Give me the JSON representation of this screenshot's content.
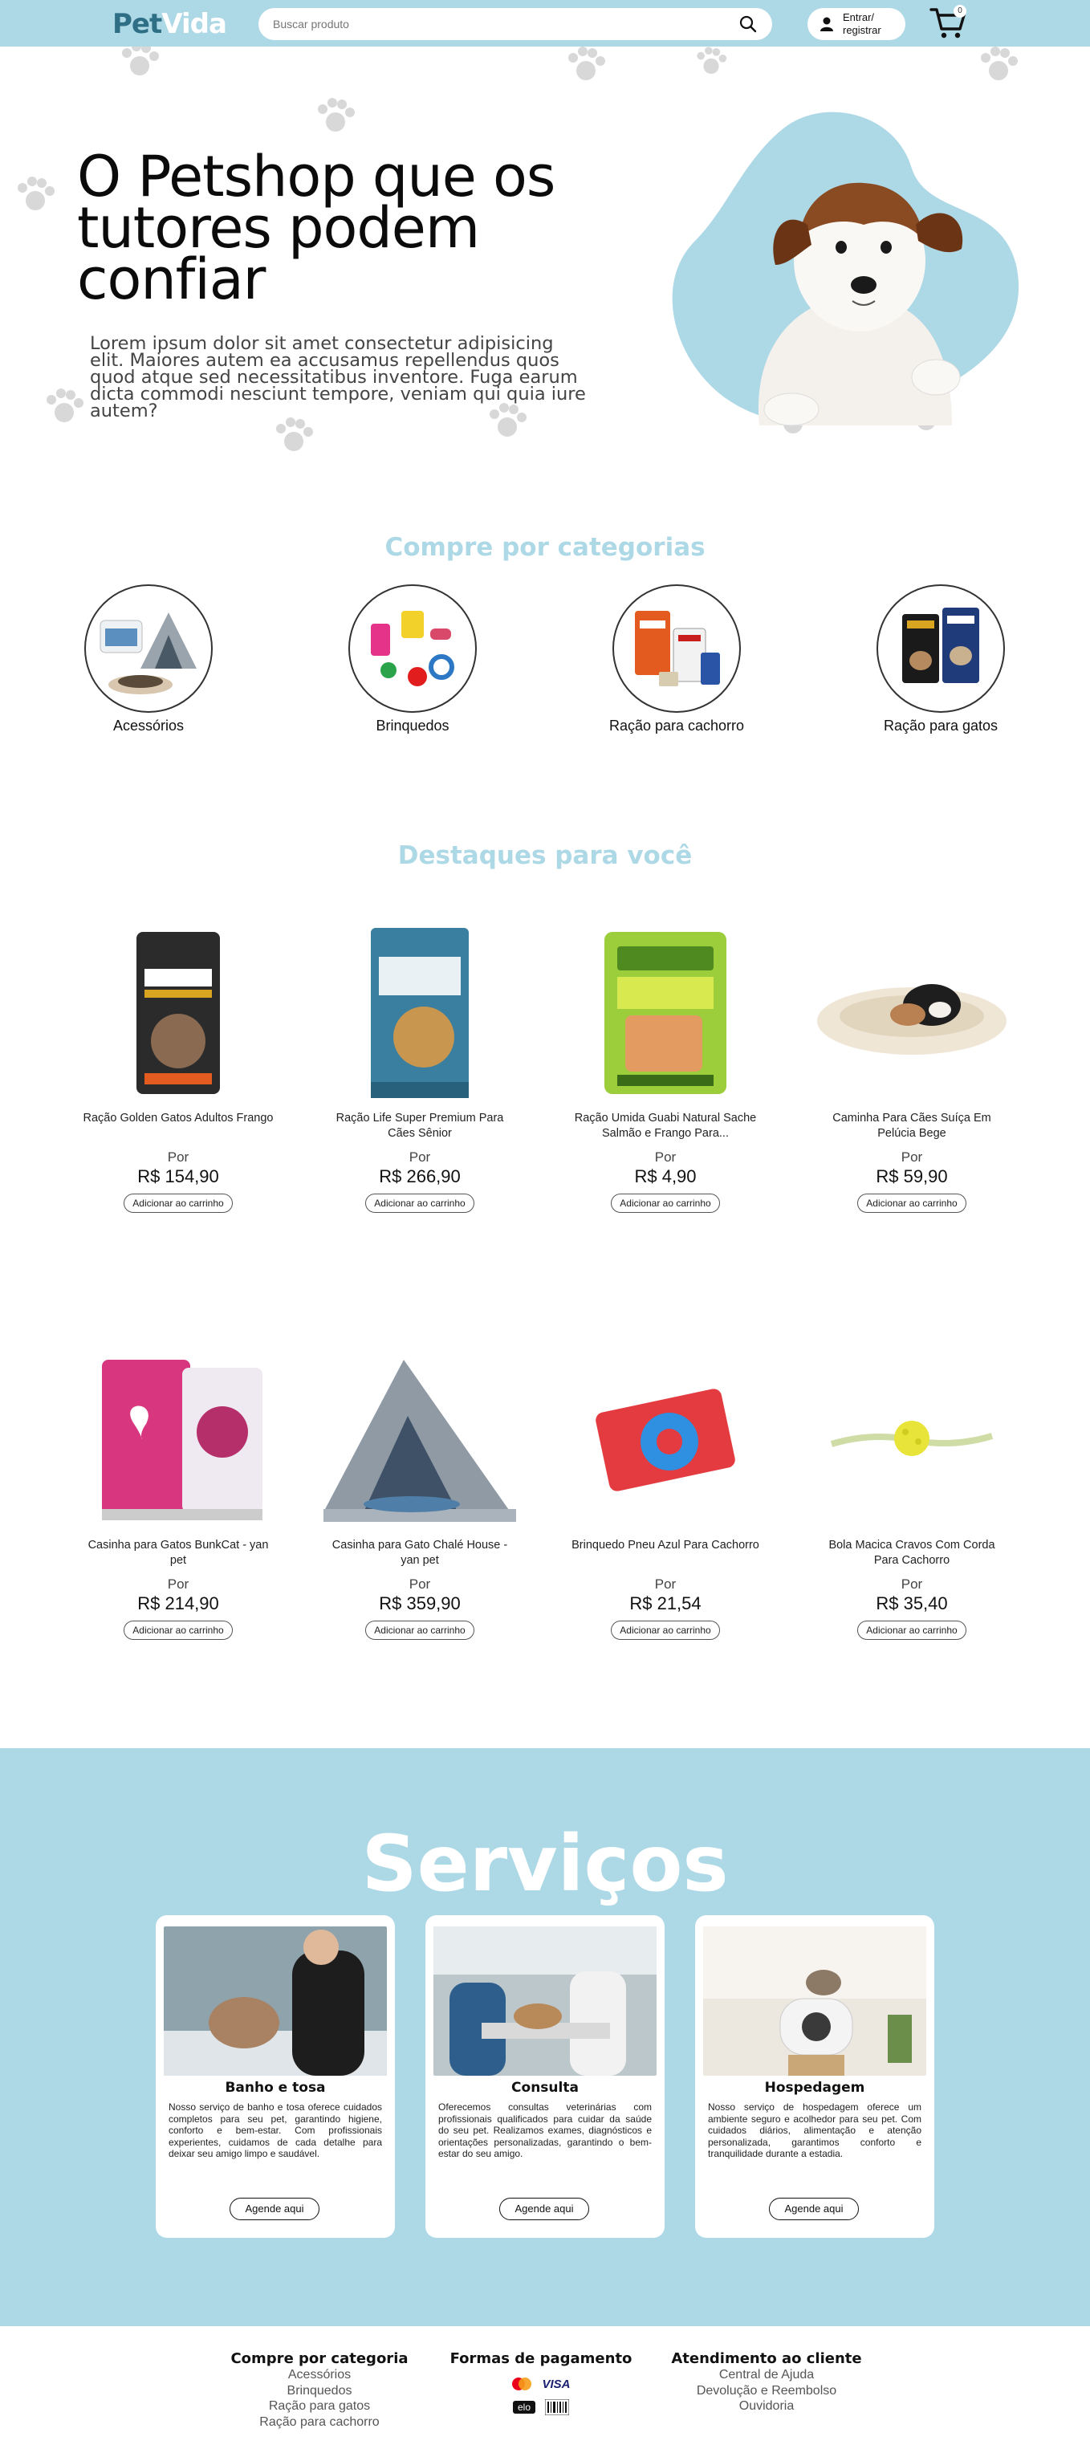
{
  "header": {
    "logo_part1": "Pet",
    "logo_part2": "Vida",
    "search_placeholder": "Buscar produto",
    "login_label_line1": "Entrar/",
    "login_label_line2": "registrar",
    "cart_count": "0"
  },
  "hero": {
    "title": "O Petshop que os tutores podem confiar",
    "text": "Lorem ipsum dolor sit amet consectetur adipisicing elit. Maiores autem ea accusamus repellendus quos quod atque sed necessitatibus inventore. Fuga earum dicta commodi nesciunt tempore, veniam qui quia iure autem?"
  },
  "categories": {
    "title": "Compre por categorias",
    "items": [
      {
        "label": "Acessórios"
      },
      {
        "label": "Brinquedos"
      },
      {
        "label": "Ração para cachorro"
      },
      {
        "label": "Ração para gatos"
      }
    ]
  },
  "featured": {
    "title": "Destaques para você",
    "por_label": "Por",
    "add_label": "Adicionar ao carrinho",
    "products": [
      {
        "name": "Ração Golden Gatos Adultos Frango",
        "price": "R$ 154,90"
      },
      {
        "name": "Ração Life Super Premium Para Cães Sênior",
        "price": "R$ 266,90"
      },
      {
        "name": "Ração Umida Guabi Natural Sache Salmão e Frango Para...",
        "price": "R$ 4,90"
      },
      {
        "name": "Caminha Para Cães Suíça Em Pelúcia Bege",
        "price": "R$ 59,90"
      },
      {
        "name": "Casinha para Gatos BunkCat - yan pet",
        "price": "R$ 214,90"
      },
      {
        "name": "Casinha para Gato Chalé House - yan pet",
        "price": "R$ 359,90"
      },
      {
        "name": "Brinquedo Pneu Azul Para Cachorro",
        "price": "R$ 21,54"
      },
      {
        "name": "Bola Macica Cravos Com Corda Para Cachorro",
        "price": "R$ 35,40"
      }
    ]
  },
  "services": {
    "title": "Serviços",
    "button_label": "Agende aqui",
    "items": [
      {
        "name": "Banho e tosa",
        "desc": "Nosso serviço de banho e tosa oferece cuidados completos para seu pet, garantindo higiene, conforto e bem-estar. Com profissionais experientes, cuidamos de cada detalhe para deixar seu amigo limpo e saudável."
      },
      {
        "name": "Consulta",
        "desc": "Oferecemos consultas veterinárias com profissionais qualificados para cuidar da saúde do seu pet. Realizamos exames, diagnósticos e orientações personalizadas, garantindo o bem-estar do seu amigo."
      },
      {
        "name": "Hospedagem",
        "desc": "Nosso serviço de hospedagem oferece um ambiente seguro e acolhedor para seu pet. Com cuidados diários, alimentação e atenção personalizada, garantimos conforto e tranquilidade durante a estadia."
      }
    ]
  },
  "footer": {
    "col1_title": "Compre por categoria",
    "col1_links": [
      "Acessórios",
      "Brinquedos",
      "Ração para gatos",
      "Ração para cachorro"
    ],
    "col2_title": "Formas de pagamento",
    "payment_icons": [
      "mastercard-icon",
      "visa-icon",
      "elo-icon",
      "boleto-icon"
    ],
    "payment_visa": "VISA",
    "payment_elo": "elo",
    "col3_title": "Atendimento ao cliente",
    "col3_links": [
      "Central de Ajuda",
      "Devolução e Reembolso",
      "Ouvidoria"
    ]
  },
  "colors": {
    "brand_light_blue": "#add8e6",
    "logo_dark": "#2f6f86"
  }
}
